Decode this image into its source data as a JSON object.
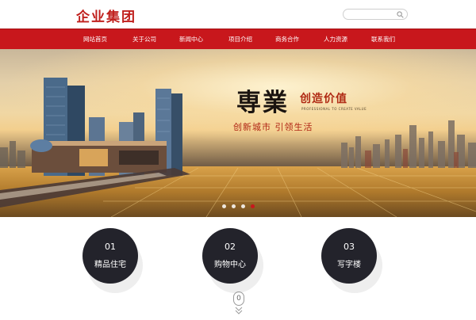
{
  "header": {
    "logo": "企业集团",
    "search": {
      "placeholder": "",
      "icon": "search-icon"
    }
  },
  "nav": {
    "items": [
      {
        "label": "网站首页"
      },
      {
        "label": "关于公司"
      },
      {
        "label": "新闻中心"
      },
      {
        "label": "项目介绍"
      },
      {
        "label": "商务合作"
      },
      {
        "label": "人力资源"
      },
      {
        "label": "联系我们"
      }
    ]
  },
  "banner": {
    "main": "専業",
    "accent": "创造价值",
    "english": "PROFESSIONAL TO CREATE VALUE",
    "subtitle": "创新城市  引领生活",
    "slides": 4,
    "active_slide": 4
  },
  "features": [
    {
      "num": "01",
      "label": "精品住宅"
    },
    {
      "num": "02",
      "label": "购物中心"
    },
    {
      "num": "03",
      "label": "写字楼"
    }
  ],
  "scroll": {
    "label": "0"
  },
  "colors": {
    "brand_red": "#c8171c",
    "circle": "#23232b"
  }
}
